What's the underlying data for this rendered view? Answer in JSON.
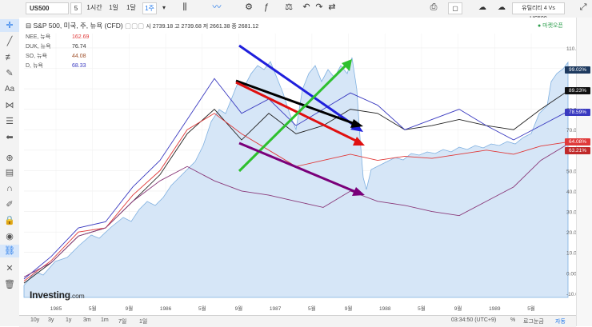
{
  "toolbar": {
    "symbol": "US500",
    "interval_value": "5",
    "intervals": [
      "1시간",
      "1일",
      "1달",
      "1주"
    ],
    "compare_title": "유틸리티 4 Vs US500"
  },
  "legend": {
    "main_title": "S&P 500, 미국, 주, 뉴욕 (CFD)",
    "ohlc": "시 2739.18  고 2739.68  저 2661.38  종 2681.12",
    "entries": [
      {
        "name": "NEE, 뉴욕",
        "value": "162.69",
        "color": "#e03a3a"
      },
      {
        "name": "DUK, 뉴욕",
        "value": "76.74",
        "color": "#333333"
      },
      {
        "name": "SO, 뉴욕",
        "value": "44.08",
        "color": "#a0522d"
      },
      {
        "name": "D, 뉴욕",
        "value": "68.33",
        "color": "#3a3ac0"
      }
    ]
  },
  "market_status": "● 마켓오픈",
  "bottom": {
    "ranges": [
      "10y",
      "3y",
      "1y",
      "3m",
      "1m",
      "7일",
      "1일"
    ],
    "time": "03:34:50 (UTC+9)",
    "pct": "%",
    "log": "로그눈금",
    "auto": "자동"
  },
  "logo": {
    "brand": "Investing",
    "suffix": ".com"
  },
  "colors": {
    "sp500_fill": "#d6e6f7",
    "sp500_line": "#7fb0e0",
    "nee": "#e03a3a",
    "duk": "#222222",
    "so": "#8a3a7a",
    "d": "#3a3ac0"
  },
  "chart_data": {
    "type": "line",
    "x_ticks": [
      "1985",
      "5월",
      "9월",
      "1986",
      "5월",
      "9월",
      "1987",
      "5월",
      "9월",
      "1988",
      "5월",
      "9월",
      "1989",
      "5월"
    ],
    "y_ticks": [
      "110.00%",
      "100.00%",
      "90.00%",
      "80.00%",
      "70.00%",
      "60.00%",
      "50.00%",
      "40.00%",
      "30.00%",
      "20.00%",
      "10.00%",
      "0.00%",
      "-10.00%"
    ],
    "ylim": [
      -12,
      117
    ],
    "series": [
      {
        "label": "99.02%",
        "color": "#3a7fc0",
        "x": [
          0,
          0.05,
          0.1,
          0.15,
          0.2,
          0.25,
          0.3,
          0.35,
          0.4,
          0.45,
          0.5,
          0.55,
          0.6,
          0.65,
          0.7,
          0.75,
          0.8,
          0.85,
          0.9,
          0.95,
          1.0
        ],
        "y": [
          -8,
          0,
          5,
          12,
          18,
          25,
          45,
          60,
          85,
          88,
          60,
          68,
          72,
          75,
          78,
          80,
          82,
          85,
          90,
          95,
          99
        ]
      },
      {
        "label": "89.23%",
        "color": "#222222",
        "x": [
          0,
          0.05,
          0.1,
          0.15,
          0.2,
          0.25,
          0.3,
          0.35,
          0.4,
          0.45,
          0.5,
          0.55,
          0.6,
          0.65,
          0.7,
          0.75,
          0.8,
          0.85,
          0.9,
          0.95,
          1.0
        ],
        "y": [
          -5,
          5,
          18,
          22,
          35,
          48,
          68,
          80,
          65,
          78,
          68,
          72,
          80,
          78,
          70,
          72,
          75,
          72,
          70,
          80,
          89
        ]
      },
      {
        "label": "78.59%",
        "color": "#3a3ac0",
        "x": [
          0,
          0.05,
          0.1,
          0.15,
          0.2,
          0.25,
          0.3,
          0.35,
          0.4,
          0.45,
          0.5,
          0.55,
          0.6,
          0.65,
          0.7,
          0.75,
          0.8,
          0.85,
          0.9,
          0.95,
          1.0
        ],
        "y": [
          -3,
          8,
          22,
          25,
          42,
          55,
          75,
          95,
          78,
          85,
          72,
          80,
          88,
          82,
          70,
          75,
          80,
          72,
          65,
          72,
          79
        ]
      },
      {
        "label": "64.08%",
        "color": "#e03a3a",
        "x": [
          0,
          0.05,
          0.1,
          0.15,
          0.2,
          0.25,
          0.3,
          0.35,
          0.4,
          0.45,
          0.5,
          0.55,
          0.6,
          0.65,
          0.7,
          0.75,
          0.8,
          0.85,
          0.9,
          0.95,
          1.0
        ],
        "y": [
          -4,
          6,
          20,
          22,
          38,
          50,
          70,
          78,
          68,
          60,
          52,
          55,
          58,
          55,
          57,
          56,
          58,
          60,
          58,
          62,
          64
        ]
      },
      {
        "label": "63.21%",
        "color": "#8a3a7a",
        "x": [
          0,
          0.05,
          0.1,
          0.15,
          0.2,
          0.25,
          0.3,
          0.35,
          0.4,
          0.45,
          0.5,
          0.55,
          0.6,
          0.65,
          0.7,
          0.75,
          0.8,
          0.85,
          0.9,
          0.95,
          1.0
        ],
        "y": [
          -2,
          5,
          18,
          22,
          35,
          45,
          52,
          45,
          40,
          38,
          35,
          32,
          40,
          35,
          33,
          30,
          28,
          35,
          42,
          55,
          63
        ]
      }
    ]
  }
}
